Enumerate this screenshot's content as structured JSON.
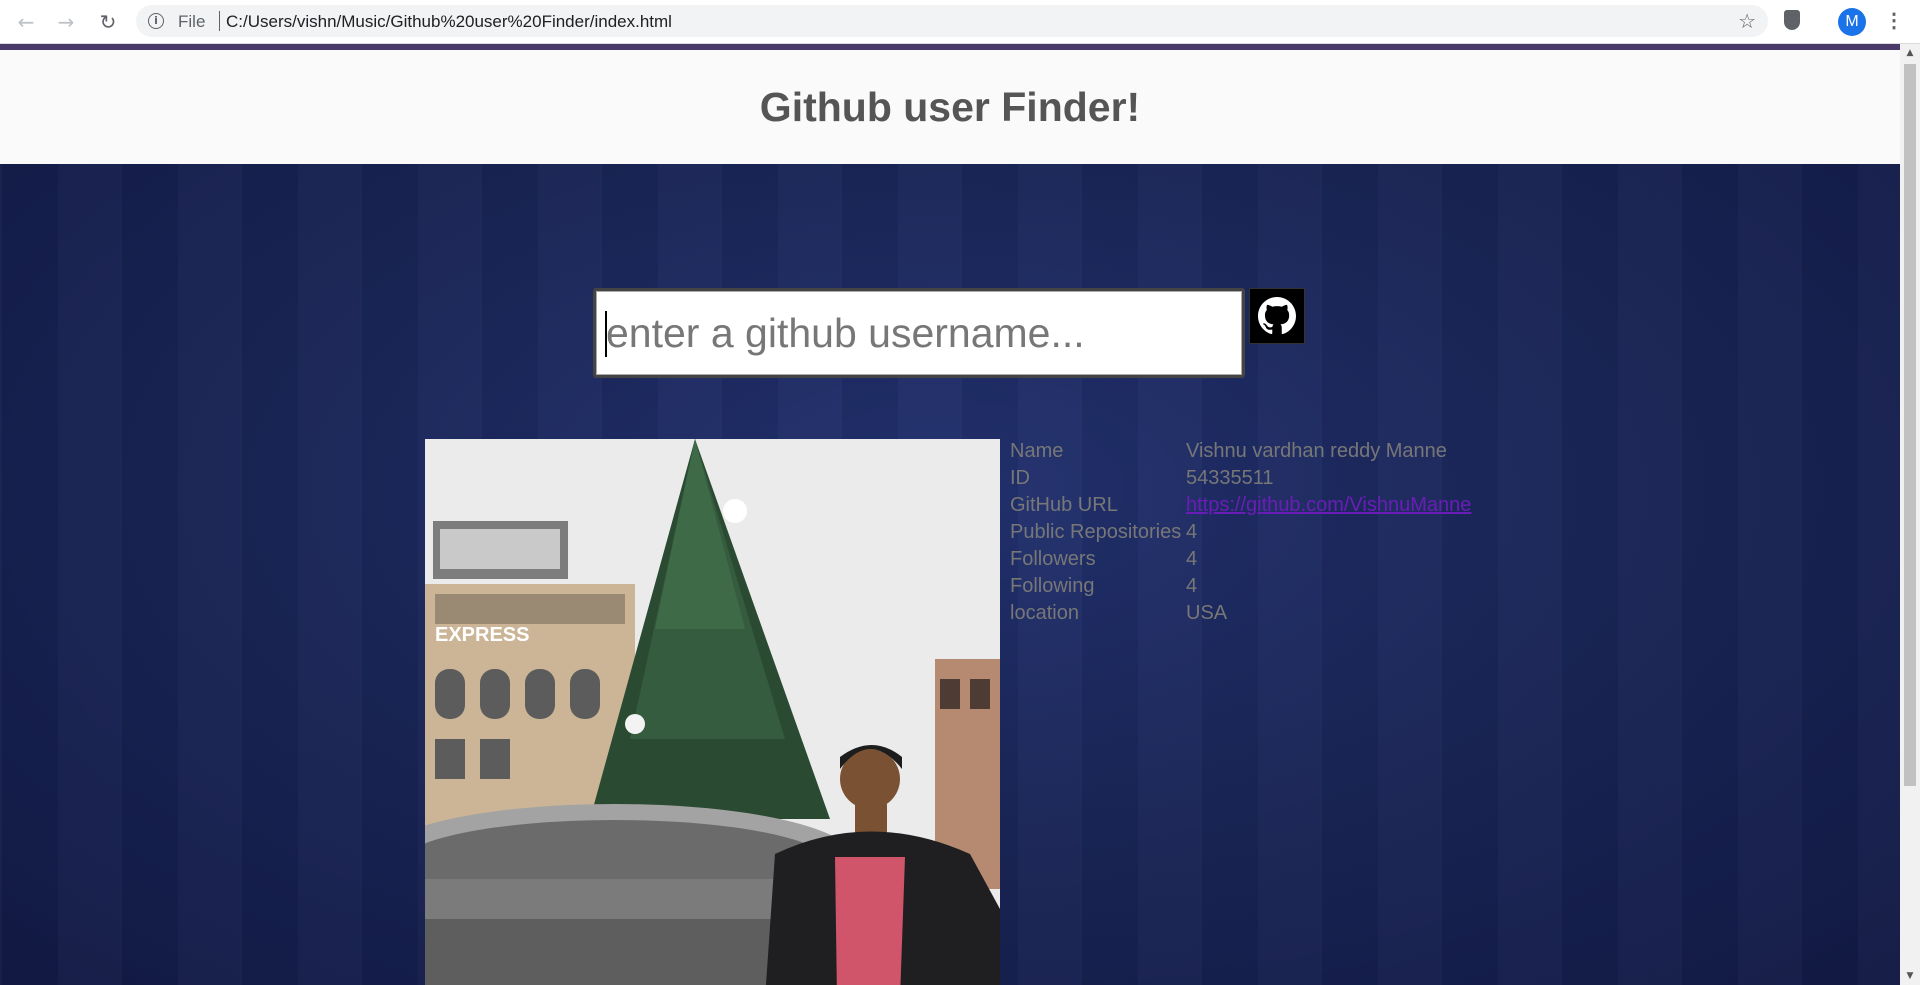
{
  "browser": {
    "back_icon": "arrow-left-icon",
    "forward_icon": "arrow-right-icon",
    "reload_icon": "reload-icon",
    "url_scheme": "File",
    "url": "C:/Users/vishn/Music/Github%20user%20Finder/index.html",
    "profile_initial": "M"
  },
  "page": {
    "title": "Github user Finder!"
  },
  "search": {
    "placeholder": "enter a github username...",
    "value": "",
    "button_icon": "github-icon"
  },
  "user": {
    "rows": [
      {
        "label": "Name",
        "value": "Vishnu vardhan reddy Manne"
      },
      {
        "label": "ID",
        "value": "54335511"
      },
      {
        "label": "GitHub URL",
        "value": "https://github.com/VishnuManne"
      },
      {
        "label": "Public Repositories",
        "value": "4"
      },
      {
        "label": "Followers",
        "value": "4"
      },
      {
        "label": "Following",
        "value": "4"
      },
      {
        "label": "location",
        "value": "USA"
      }
    ]
  },
  "colors": {
    "accent_bar": "#4a3a6a",
    "background": "#1a2658",
    "link": "#6a1db6",
    "avatar": "#1a73e8"
  }
}
